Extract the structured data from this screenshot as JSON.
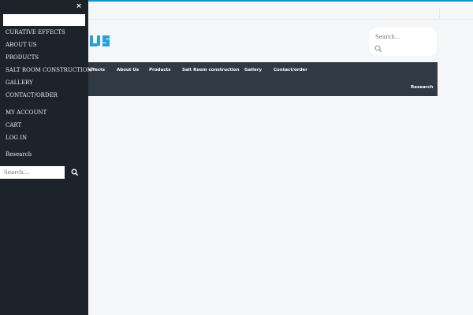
{
  "drawer": {
    "close_label": "×",
    "top_input_placeholder": "",
    "menu_primary": [
      {
        "label": "CURATIVE EFFECTS"
      },
      {
        "label": "ABOUT US"
      },
      {
        "label": "PRODUCTS"
      },
      {
        "label": "SALT ROOM CONSTRUCTION"
      },
      {
        "label": "GALLERY"
      },
      {
        "label": "CONTACT/ORDER"
      }
    ],
    "menu_account": [
      {
        "label": "MY ACCOUNT"
      },
      {
        "label": "CART"
      },
      {
        "label": "LOG IN"
      }
    ],
    "research_label": "Research",
    "search_placeholder": "Search…"
  },
  "header": {
    "search_placeholder": "Search…"
  },
  "navbar": {
    "items": [
      {
        "label": "effects"
      },
      {
        "label": "About Us"
      },
      {
        "label": "Products"
      },
      {
        "label": "Salt Room construction"
      },
      {
        "label": "Gallery"
      },
      {
        "label": "Contact/order"
      }
    ],
    "research_label": "Research"
  },
  "colors": {
    "accent": "#2a9fd6",
    "navbar_bg": "#2f3a44",
    "drawer_bg": "#1d232b",
    "page_bg": "#f5f6f8"
  },
  "icons": {
    "header_search": "search-icon",
    "drawer_search": "search-icon",
    "drawer_close": "close-icon"
  }
}
